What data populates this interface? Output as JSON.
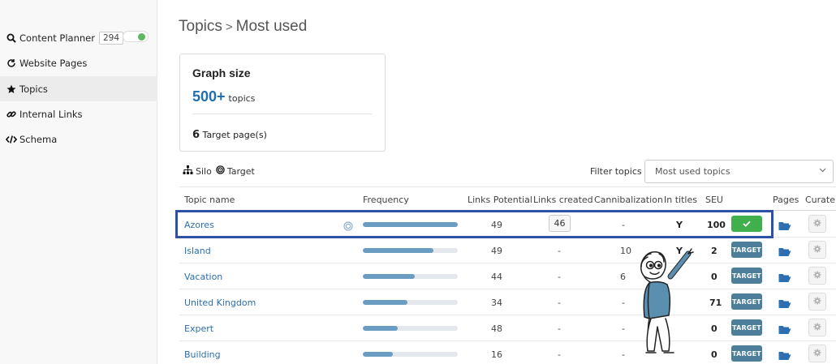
{
  "sidebar": {
    "items": [
      {
        "label": "Content Planner",
        "icon": "search-icon",
        "badge": "294"
      },
      {
        "label": "Website Pages",
        "icon": "refresh-icon"
      },
      {
        "label": "Topics",
        "icon": "star-icon"
      },
      {
        "label": "Internal Links",
        "icon": "link-icon"
      },
      {
        "label": "Schema",
        "icon": "code-icon"
      }
    ]
  },
  "header": {
    "title": "Topics",
    "separator": ">",
    "subtitle": "Most used"
  },
  "graph_card": {
    "title": "Graph size",
    "value": "500+",
    "unit": "topics",
    "target_count": "6",
    "target_label": "Target page(s)"
  },
  "legend": {
    "silo": "Silo",
    "target": "Target"
  },
  "filter": {
    "label": "Filter topics",
    "selected": "Most used topics"
  },
  "table": {
    "headers": [
      "Topic name",
      "Frequency",
      "Links Potential",
      "Links created",
      "Cannibalization",
      "In titles",
      "SEU",
      "Pages",
      "Curate"
    ],
    "rows": [
      {
        "name": "Azores",
        "freq": 1.0,
        "potential": "49",
        "created": "46",
        "cannibal": "-",
        "in_titles": "Y",
        "seu": "100",
        "action": "check"
      },
      {
        "name": "Island",
        "freq": 0.74,
        "potential": "49",
        "created": "-",
        "cannibal": "10",
        "in_titles": "Y",
        "seu": "2",
        "action": "TARGET"
      },
      {
        "name": "Vacation",
        "freq": 0.55,
        "potential": "44",
        "created": "-",
        "cannibal": "6",
        "in_titles": "",
        "seu": "0",
        "action": "TARGET"
      },
      {
        "name": "United Kingdom",
        "freq": 0.47,
        "potential": "34",
        "created": "-",
        "cannibal": "-",
        "in_titles": "",
        "seu": "71",
        "action": "TARGET"
      },
      {
        "name": "Expert",
        "freq": 0.37,
        "potential": "48",
        "created": "-",
        "cannibal": "-",
        "in_titles": "",
        "seu": "0",
        "action": "TARGET"
      },
      {
        "name": "Building",
        "freq": 0.32,
        "potential": "16",
        "created": "-",
        "cannibal": "-",
        "in_titles": "",
        "seu": "0",
        "action": "TARGET"
      }
    ]
  },
  "colors": {
    "accent": "#1f6fb2",
    "target_button": "#4d7f9b",
    "check_button": "#3fb04b",
    "highlight": "#2d51a4"
  }
}
